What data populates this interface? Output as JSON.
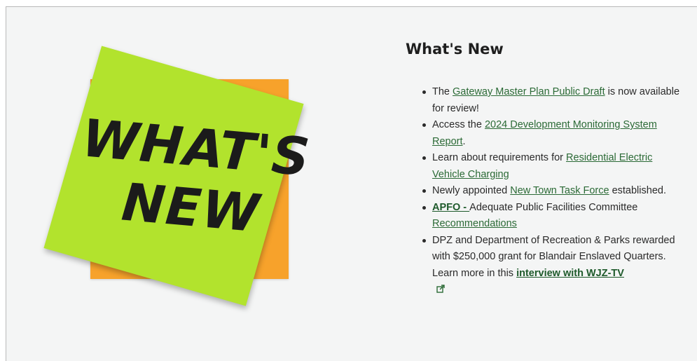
{
  "section": {
    "heading": "What's New"
  },
  "sticky_note": {
    "line1": "WHAT'S",
    "line2": "NEW",
    "colors": {
      "green": "#b2e32d",
      "orange": "#f7a22b"
    }
  },
  "news": [
    {
      "before": "The ",
      "link": "Gateway Master Plan Public Draft",
      "after": " is now available for review!"
    },
    {
      "before": "Access the ",
      "link": "2024 Development Monitoring System Report",
      "after": "."
    },
    {
      "before": "Learn about requirements for ",
      "link": "Residential Electric Vehicle Charging",
      "after": ""
    },
    {
      "before": "Newly appointed ",
      "link": "New Town Task Force",
      "after": " established."
    },
    {
      "before": "",
      "link": "APFO - ",
      "after": "Adequate Public Facilities Committee ",
      "link2": "Recommendations"
    },
    {
      "before": "DPZ and Department of Recreation & Parks rewarded with $250,000 grant for Blandair Enslaved Quarters. Learn more in this ",
      "link": "interview with WJZ-TV",
      "after": ""
    }
  ],
  "icons": {
    "external": "external-link-icon"
  },
  "colors": {
    "link": "#2b6a36",
    "panel_bg": "#f4f5f5"
  }
}
